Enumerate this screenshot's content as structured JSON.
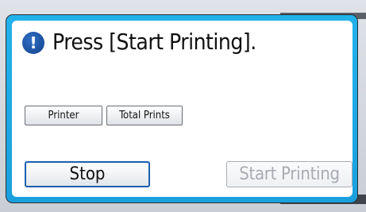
{
  "dialog": {
    "icon": "info-icon",
    "icon_glyph": "!",
    "message": "Press [Start Printing]."
  },
  "buttons": {
    "printer_label": "Printer",
    "total_prints_label": "Total Prints",
    "stop_label": "Stop",
    "start_printing_label": "Start Printing",
    "start_printing_enabled": false
  },
  "colors": {
    "frame": "#1aa0dd",
    "icon": "#13418f",
    "stop_border": "#1b5fb0",
    "disabled_text": "#a8acb1"
  }
}
